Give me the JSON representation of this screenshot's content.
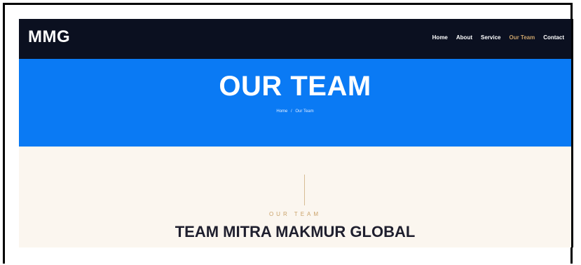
{
  "navbar": {
    "logo": "MMG",
    "items": [
      {
        "label": "Home"
      },
      {
        "label": "About"
      },
      {
        "label": "Service"
      },
      {
        "label": "Our Team"
      },
      {
        "label": "Contact"
      }
    ],
    "active_color": "#c9a26a",
    "background": "#0b1020"
  },
  "hero": {
    "title": "OUR TEAM",
    "breadcrumb": {
      "home": "Home",
      "separator": "/",
      "current": "Our Team"
    },
    "background": "#0a7af4"
  },
  "section": {
    "eyebrow": "OUR TEAM",
    "heading": "TEAM MITRA MAKMUR GLOBAL",
    "background": "#fbf6ef"
  }
}
